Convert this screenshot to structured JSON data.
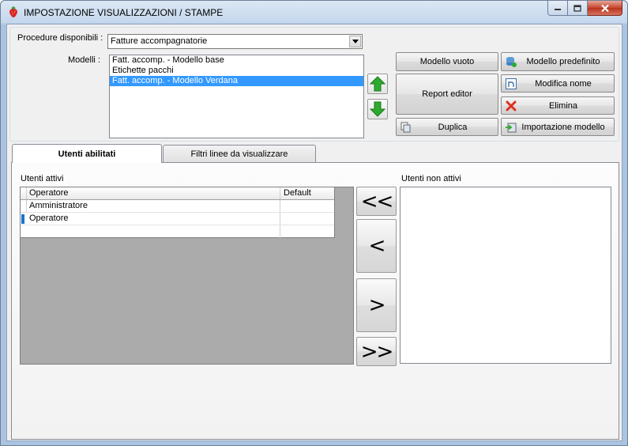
{
  "window": {
    "title": "IMPOSTAZIONE VISUALIZZAZIONI / STAMPE",
    "app_icon": "strawberry-icon"
  },
  "procedure": {
    "label": "Procedure disponibili :",
    "selected": "Fatture accompagnatorie"
  },
  "modelli": {
    "label": "Modelli :",
    "items": [
      {
        "text": "Fatt. accomp. - Modello base",
        "selected": false
      },
      {
        "text": "Etichette pacchi",
        "selected": false
      },
      {
        "text": "Fatt. accomp. - Modello Verdana",
        "selected": true
      }
    ]
  },
  "buttons": {
    "modello_vuoto": "Modello vuoto",
    "modello_predefinito": "Modello predefinito",
    "report_editor": "Report editor",
    "modifica_nome": "Modifica nome",
    "elimina": "Elimina",
    "duplica": "Duplica",
    "importazione_modello": "Importazione modello"
  },
  "tabs": [
    {
      "label": "Utenti abilitati",
      "active": true
    },
    {
      "label": "Filtri linee da visualizzare",
      "active": false
    }
  ],
  "utenti_attivi": {
    "label": "Utenti attivi",
    "columns": [
      "Operatore",
      "Default"
    ],
    "rows": [
      {
        "operatore": "Amministratore",
        "default": ""
      },
      {
        "operatore": "Operatore",
        "default": ""
      }
    ]
  },
  "utenti_non_attivi": {
    "label": "Utenti non attivi"
  },
  "move_buttons": {
    "all_left": "<<",
    "left": "<",
    "right": ">",
    "all_right": ">>"
  },
  "colors": {
    "selection": "#3399ff",
    "arrow_green": "#2eaa2e",
    "close_red": "#c7442f"
  }
}
